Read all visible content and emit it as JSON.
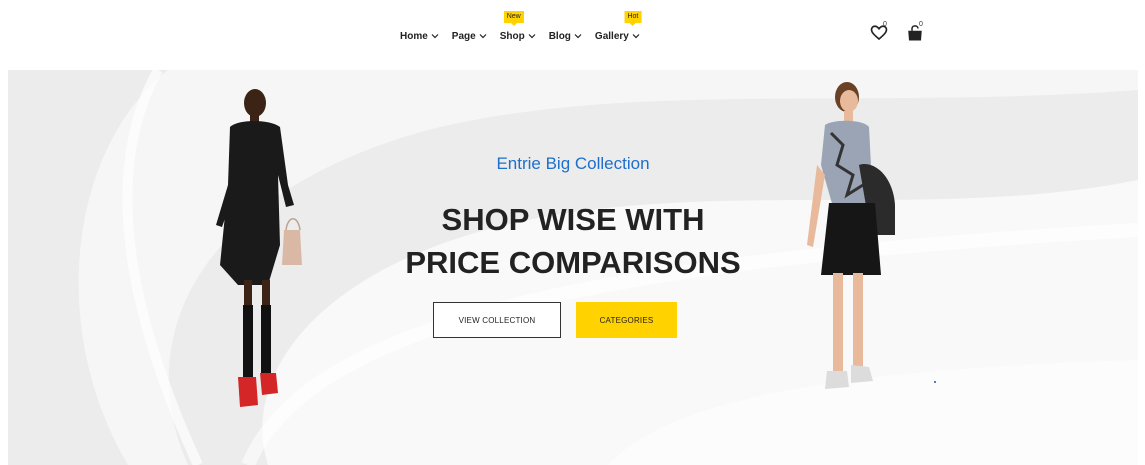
{
  "nav": {
    "items": [
      {
        "label": "Home",
        "badge": ""
      },
      {
        "label": "Page",
        "badge": ""
      },
      {
        "label": "Shop",
        "badge": "New"
      },
      {
        "label": "Blog",
        "badge": ""
      },
      {
        "label": "Gallery",
        "badge": "Hot"
      }
    ]
  },
  "header_icons": {
    "wishlist": {
      "icon": "heart-icon",
      "count": "0"
    },
    "cart": {
      "icon": "shopping-bag-icon",
      "count": "0"
    }
  },
  "hero": {
    "subtitle": "Entrie Big Collection",
    "title_line1": "SHOP WISE WITH",
    "title_line2": "PRICE COMPARISONS",
    "primary_button": "VIEW COLLECTION",
    "secondary_button": "CATEGORIES"
  },
  "colors": {
    "accent_yellow": "#ffd200",
    "subtitle_blue": "#1d6fc9",
    "hero_bg": "#ececec",
    "text_dark": "#222222"
  }
}
